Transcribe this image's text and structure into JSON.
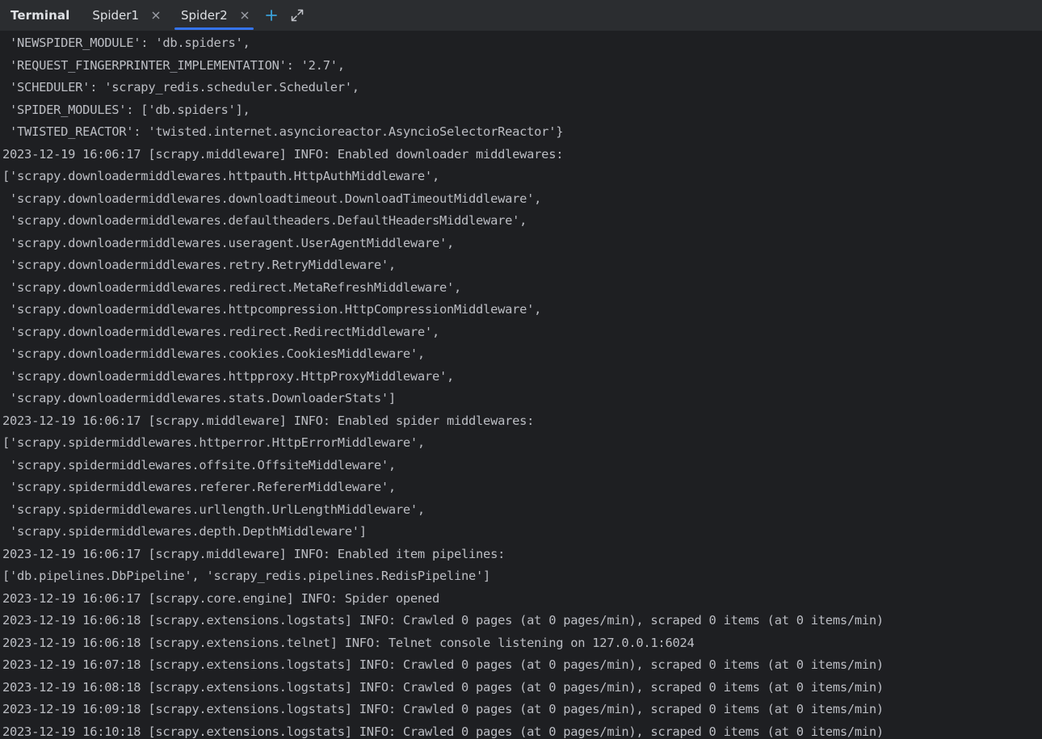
{
  "tabbar": {
    "title": "Terminal",
    "tabs": [
      {
        "label": "Spider1",
        "active": false
      },
      {
        "label": "Spider2",
        "active": true
      }
    ],
    "add_icon": "plus-icon",
    "maximize_icon": "expand-icon",
    "close_icon": "close-icon",
    "accent_color": "#3574f0",
    "add_color": "#3aa0d8"
  },
  "terminal": {
    "lines": [
      " 'NEWSPIDER_MODULE': 'db.spiders',",
      " 'REQUEST_FINGERPRINTER_IMPLEMENTATION': '2.7',",
      " 'SCHEDULER': 'scrapy_redis.scheduler.Scheduler',",
      " 'SPIDER_MODULES': ['db.spiders'],",
      " 'TWISTED_REACTOR': 'twisted.internet.asyncioreactor.AsyncioSelectorReactor'}",
      "2023-12-19 16:06:17 [scrapy.middleware] INFO: Enabled downloader middlewares:",
      "['scrapy.downloadermiddlewares.httpauth.HttpAuthMiddleware',",
      " 'scrapy.downloadermiddlewares.downloadtimeout.DownloadTimeoutMiddleware',",
      " 'scrapy.downloadermiddlewares.defaultheaders.DefaultHeadersMiddleware',",
      " 'scrapy.downloadermiddlewares.useragent.UserAgentMiddleware',",
      " 'scrapy.downloadermiddlewares.retry.RetryMiddleware',",
      " 'scrapy.downloadermiddlewares.redirect.MetaRefreshMiddleware',",
      " 'scrapy.downloadermiddlewares.httpcompression.HttpCompressionMiddleware',",
      " 'scrapy.downloadermiddlewares.redirect.RedirectMiddleware',",
      " 'scrapy.downloadermiddlewares.cookies.CookiesMiddleware',",
      " 'scrapy.downloadermiddlewares.httpproxy.HttpProxyMiddleware',",
      " 'scrapy.downloadermiddlewares.stats.DownloaderStats']",
      "2023-12-19 16:06:17 [scrapy.middleware] INFO: Enabled spider middlewares:",
      "['scrapy.spidermiddlewares.httperror.HttpErrorMiddleware',",
      " 'scrapy.spidermiddlewares.offsite.OffsiteMiddleware',",
      " 'scrapy.spidermiddlewares.referer.RefererMiddleware',",
      " 'scrapy.spidermiddlewares.urllength.UrlLengthMiddleware',",
      " 'scrapy.spidermiddlewares.depth.DepthMiddleware']",
      "2023-12-19 16:06:17 [scrapy.middleware] INFO: Enabled item pipelines:",
      "['db.pipelines.DbPipeline', 'scrapy_redis.pipelines.RedisPipeline']",
      "2023-12-19 16:06:17 [scrapy.core.engine] INFO: Spider opened",
      "2023-12-19 16:06:18 [scrapy.extensions.logstats] INFO: Crawled 0 pages (at 0 pages/min), scraped 0 items (at 0 items/min)",
      "2023-12-19 16:06:18 [scrapy.extensions.telnet] INFO: Telnet console listening on 127.0.0.1:6024",
      "2023-12-19 16:07:18 [scrapy.extensions.logstats] INFO: Crawled 0 pages (at 0 pages/min), scraped 0 items (at 0 items/min)",
      "2023-12-19 16:08:18 [scrapy.extensions.logstats] INFO: Crawled 0 pages (at 0 pages/min), scraped 0 items (at 0 items/min)",
      "2023-12-19 16:09:18 [scrapy.extensions.logstats] INFO: Crawled 0 pages (at 0 pages/min), scraped 0 items (at 0 items/min)",
      "2023-12-19 16:10:18 [scrapy.extensions.logstats] INFO: Crawled 0 pages (at 0 pages/min), scraped 0 items (at 0 items/min)"
    ]
  }
}
